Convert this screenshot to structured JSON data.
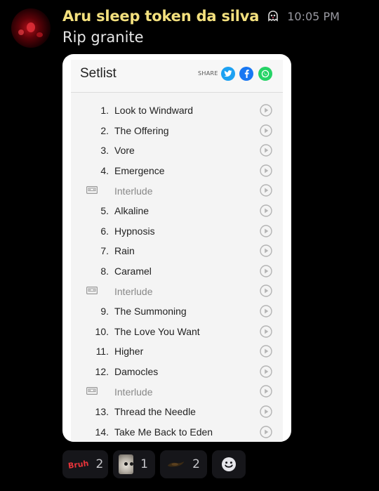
{
  "message": {
    "username": "Aru sleep token da silva",
    "timestamp": "10:05 PM",
    "text": "Rip granite"
  },
  "embed": {
    "title": "Setlist",
    "share_label": "SHARE",
    "share_buttons": [
      "twitter-icon",
      "facebook-icon",
      "whatsapp-icon"
    ],
    "songs": [
      {
        "num": "1.",
        "title": "Look to Windward",
        "interlude": false
      },
      {
        "num": "2.",
        "title": "The Offering",
        "interlude": false
      },
      {
        "num": "3.",
        "title": "Vore",
        "interlude": false
      },
      {
        "num": "4.",
        "title": "Emergence",
        "interlude": false
      },
      {
        "num": "",
        "title": "Interlude",
        "interlude": true
      },
      {
        "num": "5.",
        "title": "Alkaline",
        "interlude": false
      },
      {
        "num": "6.",
        "title": "Hypnosis",
        "interlude": false
      },
      {
        "num": "7.",
        "title": "Rain",
        "interlude": false
      },
      {
        "num": "8.",
        "title": "Caramel",
        "interlude": false
      },
      {
        "num": "",
        "title": "Interlude",
        "interlude": true
      },
      {
        "num": "9.",
        "title": "The Summoning",
        "interlude": false
      },
      {
        "num": "10.",
        "title": "The Love You Want",
        "interlude": false
      },
      {
        "num": "11.",
        "title": "Higher",
        "interlude": false
      },
      {
        "num": "12.",
        "title": "Damocles",
        "interlude": false
      },
      {
        "num": "",
        "title": "Interlude",
        "interlude": true
      },
      {
        "num": "13.",
        "title": "Thread the Needle",
        "interlude": false
      },
      {
        "num": "14.",
        "title": "Take Me Back to Eden",
        "interlude": false
      }
    ]
  },
  "reactions": [
    {
      "emoji": "bruh-emoji",
      "label": "Bruh",
      "count": "2"
    },
    {
      "emoji": "cat-emoji",
      "count": "1"
    },
    {
      "emoji": "brown-emoji",
      "count": "2"
    }
  ],
  "colors": {
    "username": "#f3e07e",
    "twitter": "#1da1f2",
    "facebook": "#1877f2",
    "whatsapp": "#25d366",
    "bruh": "#e8343a"
  }
}
